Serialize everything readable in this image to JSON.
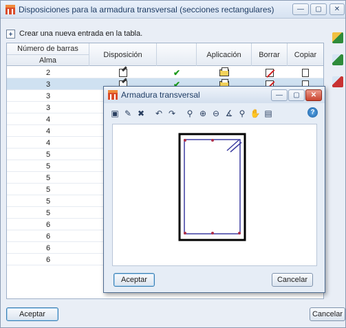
{
  "window": {
    "title": "Disposiciones para la armadura transversal (secciones rectangulares)",
    "minimize_glyph": "—",
    "maximize_glyph": "▢",
    "close_glyph": "✕"
  },
  "toolbar": {
    "new_entry_label": "Crear una nueva entrada en la tabla."
  },
  "table": {
    "headers": {
      "nbars_top": "Número de barras",
      "nbars_bottom": "Alma",
      "disposicion": "Disposición",
      "check": "",
      "aplicacion": "Aplicación",
      "borrar": "Borrar",
      "copiar": "Copiar"
    },
    "rows": [
      {
        "num": "2",
        "selected": false
      },
      {
        "num": "3",
        "selected": true
      },
      {
        "num": "3",
        "selected": false
      },
      {
        "num": "3",
        "selected": false
      },
      {
        "num": "4",
        "selected": false
      },
      {
        "num": "4",
        "selected": false
      },
      {
        "num": "4",
        "selected": false
      },
      {
        "num": "5",
        "selected": false
      },
      {
        "num": "5",
        "selected": false
      },
      {
        "num": "5",
        "selected": false
      },
      {
        "num": "5",
        "selected": false
      },
      {
        "num": "5",
        "selected": false
      },
      {
        "num": "5",
        "selected": false
      },
      {
        "num": "6",
        "selected": false
      },
      {
        "num": "6",
        "selected": false
      },
      {
        "num": "6",
        "selected": false
      },
      {
        "num": "6",
        "selected": false
      }
    ],
    "check_glyph": "✔"
  },
  "side_icons": [
    "add-multiple-icon",
    "import-icon",
    "export-icon"
  ],
  "buttons": {
    "accept": "Aceptar",
    "cancel": "Cancelar"
  },
  "dialog": {
    "title": "Armadura transversal",
    "minimize_glyph": "—",
    "maximize_glyph": "▢",
    "close_glyph": "✕",
    "help_glyph": "?",
    "tools": [
      "▣",
      "✎",
      "✖",
      "↶",
      "↷",
      "⚲",
      "⊕",
      "⊖",
      "∡",
      "⚲",
      "✋",
      "▤"
    ],
    "accept": "Aceptar",
    "cancel": "Cancelar"
  },
  "colors": {
    "selection": "#cfe1f1",
    "check": "#1c9a1c",
    "stirrup": "#3c3ca0",
    "section": "#000000"
  }
}
